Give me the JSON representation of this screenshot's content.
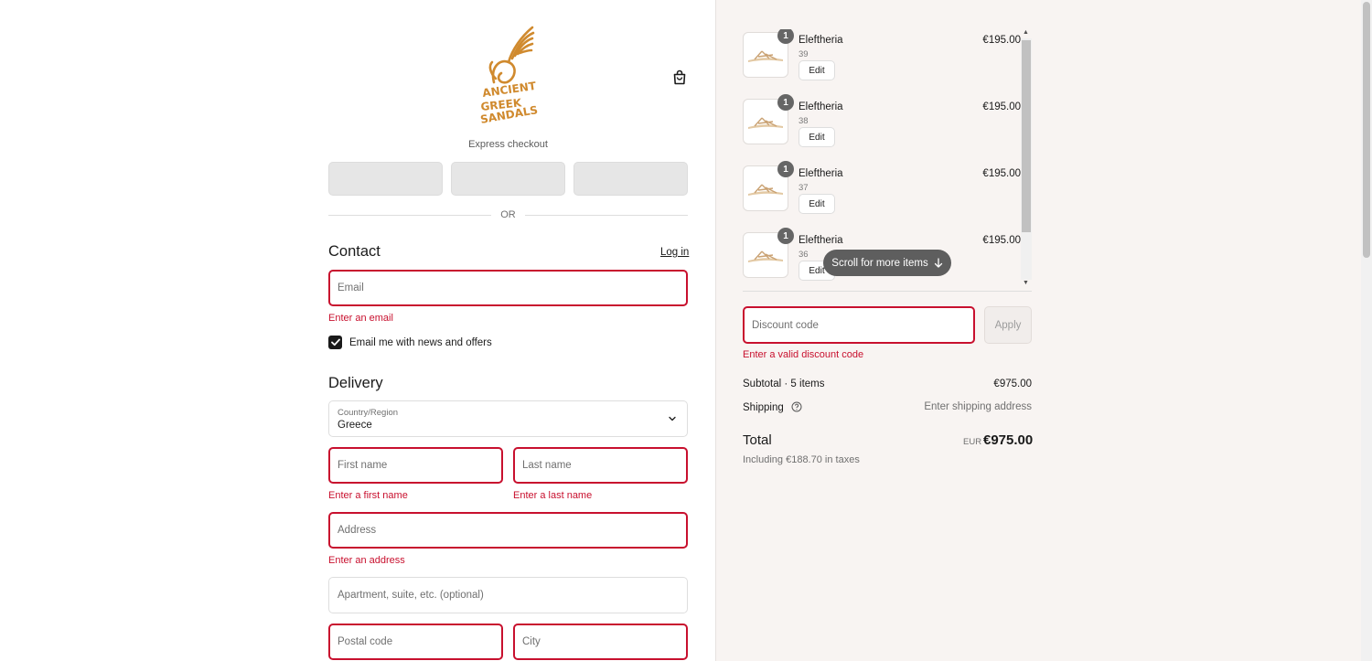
{
  "brand": {
    "logo_lines": [
      "ANCIENT",
      "GREEK",
      "SANDALS"
    ],
    "logo_color": "#d08a2e"
  },
  "header": {
    "cart_icon": "shopping-bag-icon"
  },
  "express": {
    "title": "Express checkout",
    "or_label": "OR"
  },
  "contact": {
    "title": "Contact",
    "login_label": "Log in",
    "email_placeholder": "Email",
    "email_error": "Enter an email",
    "newsletter_label": "Email me with news and offers",
    "newsletter_checked": true
  },
  "delivery": {
    "title": "Delivery",
    "country_label": "Country/Region",
    "country_value": "Greece",
    "first_name_placeholder": "First name",
    "first_name_error": "Enter a first name",
    "last_name_placeholder": "Last name",
    "last_name_error": "Enter a last name",
    "address_placeholder": "Address",
    "address_error": "Enter an address",
    "apartment_placeholder": "Apartment, suite, etc. (optional)",
    "postal_placeholder": "Postal code",
    "city_placeholder": "City"
  },
  "cart": {
    "items": [
      {
        "name": "Eleftheria",
        "size": "39",
        "qty": "1",
        "price": "€195.00",
        "edit_label": "Edit"
      },
      {
        "name": "Eleftheria",
        "size": "38",
        "qty": "1",
        "price": "€195.00",
        "edit_label": "Edit"
      },
      {
        "name": "Eleftheria",
        "size": "37",
        "qty": "1",
        "price": "€195.00",
        "edit_label": "Edit"
      },
      {
        "name": "Eleftheria",
        "size": "36",
        "qty": "1",
        "price": "€195.00",
        "edit_label": "Edit"
      }
    ],
    "scroll_hint": "Scroll for more items"
  },
  "discount": {
    "placeholder": "Discount code",
    "apply_label": "Apply",
    "error": "Enter a valid discount code"
  },
  "summary": {
    "subtotal_label": "Subtotal · 5 items",
    "subtotal_value": "€975.00",
    "shipping_label": "Shipping",
    "shipping_value": "Enter shipping address",
    "total_label": "Total",
    "total_currency": "EUR",
    "total_value": "€975.00",
    "tax_line": "Including €188.70 in taxes"
  },
  "colors": {
    "error": "#c8102e",
    "summary_bg": "#f8f4f2",
    "express_button": "#e6e6e6"
  }
}
